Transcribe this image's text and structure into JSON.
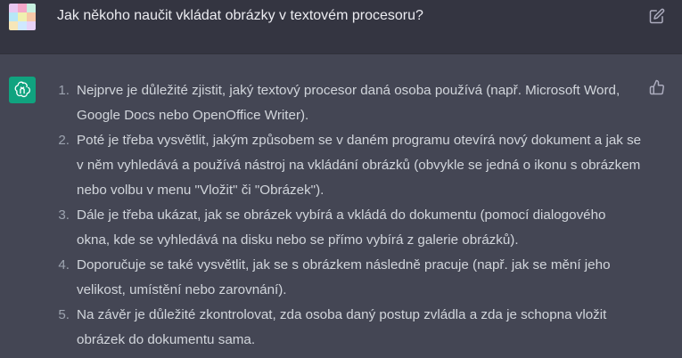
{
  "user": {
    "message": "Jak někoho naučit vkládat obrázky v textovém procesoru?",
    "avatar_colors": [
      "#e9c7f0",
      "#f5a7c9",
      "#c7f0e0",
      "#b7e7f7",
      "#f0f0b0",
      "#f7c8a8",
      "#f6e6b8",
      "#cfe8ff",
      "#e8d2f7"
    ],
    "edit_icon": "edit-icon"
  },
  "assistant": {
    "logo_icon": "openai-logo-icon",
    "feedback_icon": "thumbs-up-icon",
    "items": [
      {
        "num": "1.",
        "text": "Nejprve je důležité zjistit, jaký textový procesor daná osoba používá (např. Microsoft Word, Google Docs nebo OpenOffice Writer)."
      },
      {
        "num": "2.",
        "text": "Poté je třeba vysvětlit, jakým způsobem se v daném programu otevírá nový dokument a jak se v něm vyhledává a používá nástroj na vkládání obrázků (obvykle se jedná o ikonu s obrázkem nebo volbu v menu \"Vložit\" či \"Obrázek\")."
      },
      {
        "num": "3.",
        "text": "Dále je třeba ukázat, jak se obrázek vybírá a vkládá do dokumentu (pomocí dialogového okna, kde se vyhledává na disku nebo se přímo vybírá z galerie obrázků)."
      },
      {
        "num": "4.",
        "text": "Doporučuje se také vysvětlit, jak se s obrázkem následně pracuje (např. jak se mění jeho velikost, umístění nebo zarovnání)."
      },
      {
        "num": "5.",
        "text": "Na závěr je důležité zkontrolovat, zda osoba daný postup zvládla a zda je schopna vložit obrázek do dokumentu sama."
      }
    ]
  }
}
